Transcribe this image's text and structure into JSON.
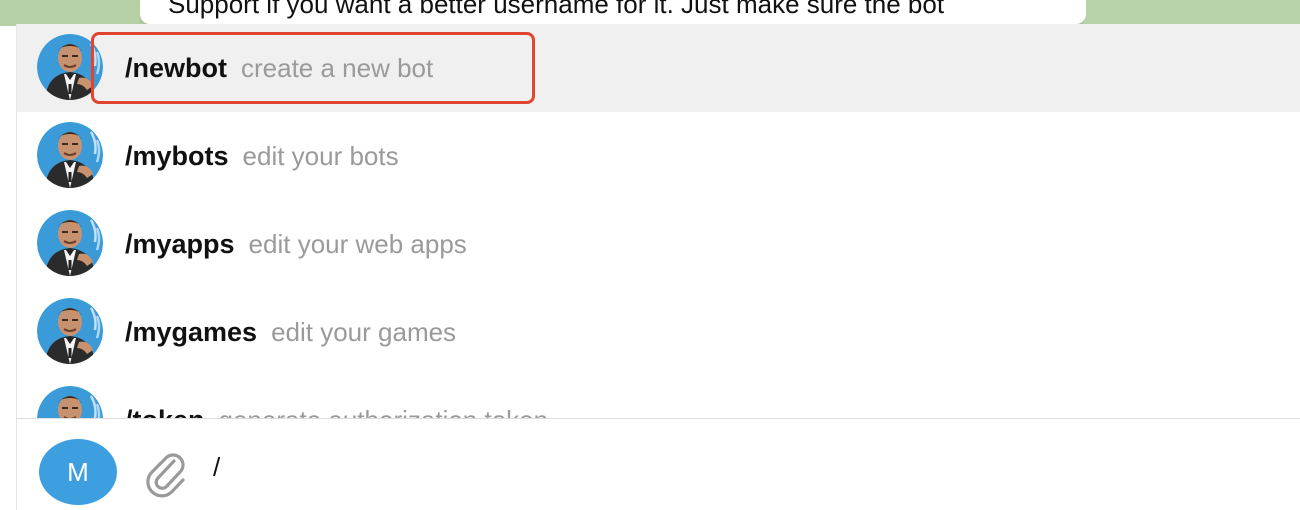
{
  "chat": {
    "partial_message": "Support if you want a better username for it. Just make sure the bot"
  },
  "commands": [
    {
      "name": "/newbot",
      "description": "create a new bot",
      "selected": true
    },
    {
      "name": "/mybots",
      "description": "edit your bots",
      "selected": false
    },
    {
      "name": "/myapps",
      "description": "edit your web apps",
      "selected": false
    },
    {
      "name": "/mygames",
      "description": "edit your games",
      "selected": false
    },
    {
      "name": "/token",
      "description": "generate authorization token",
      "selected": false
    }
  ],
  "composer": {
    "avatar_initial": "M",
    "input_value": "/"
  },
  "colors": {
    "highlight_border": "#e2452f",
    "selected_row": "#f0f0f0",
    "user_avatar": "#3d9ee0",
    "description_text": "#9a9a9a"
  },
  "icons": {
    "bot_avatar": "botfather-avatar",
    "attach": "paperclip-icon"
  }
}
